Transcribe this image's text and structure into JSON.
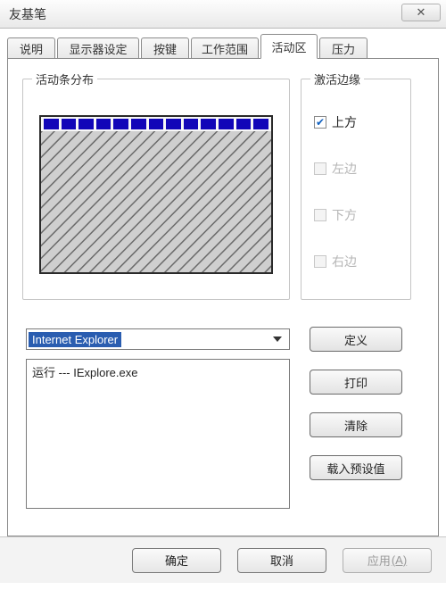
{
  "window": {
    "title": "友基笔"
  },
  "tabs": {
    "t0": "说明",
    "t1": "显示器设定",
    "t2": "按键",
    "t3": "工作范围",
    "t4": "活动区",
    "t5": "压力"
  },
  "groupbox": {
    "activebar_title": "活动条分布",
    "edges_title": "激活边缘"
  },
  "edges": {
    "top": {
      "label": "上方",
      "checked": true,
      "enabled": true
    },
    "left": {
      "label": "左边",
      "checked": false,
      "enabled": false
    },
    "bottom": {
      "label": "下方",
      "checked": false,
      "enabled": false
    },
    "right": {
      "label": "右边",
      "checked": false,
      "enabled": false
    }
  },
  "combo": {
    "selected": "Internet Explorer"
  },
  "listbox": {
    "line0": "运行 --- IExplore.exe"
  },
  "buttons": {
    "define": "定义",
    "print": "打印",
    "clear": "清除",
    "load_preset": "载入预设值"
  },
  "footer": {
    "ok": "确定",
    "cancel": "取消",
    "apply": "应用",
    "apply_mn": "(A)"
  }
}
